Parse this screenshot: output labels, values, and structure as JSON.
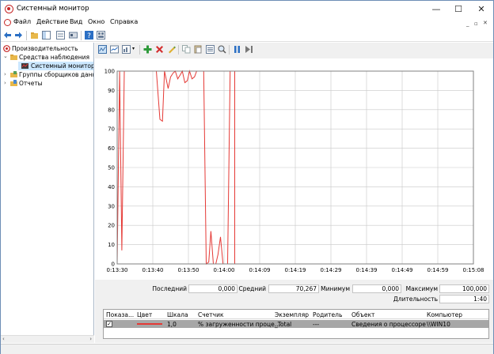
{
  "window": {
    "title": "Системный монитор",
    "minimize": "—",
    "maximize": "☐",
    "close": "✕"
  },
  "menu": [
    "Файл",
    "Действие",
    "Вид",
    "Окно",
    "Справка"
  ],
  "tree": {
    "root": "Производительность",
    "monitoring": "Средства наблюдения",
    "system_monitor": "Системный монитор",
    "collector_groups": "Группы сборщиков данн",
    "reports": "Отчеты"
  },
  "colors": {
    "series": "#e53935",
    "selection": "#cce8ff",
    "legend_row": "#a7a7a7"
  },
  "chart_data": {
    "type": "line",
    "y_ticks": [
      0,
      10,
      20,
      30,
      40,
      50,
      60,
      70,
      80,
      90,
      100
    ],
    "x_labels": [
      "0:13:30",
      "0:13:40",
      "0:13:50",
      "0:14:00",
      "0:14:09",
      "0:14:19",
      "0:14:29",
      "0:14:39",
      "0:14:49",
      "0:14:59",
      "0:15:08"
    ],
    "ylim": [
      0,
      100
    ],
    "duration_seconds": 100,
    "series": [
      {
        "x": [
          0,
          0.7,
          1.3,
          2,
          3,
          3.5,
          4.3,
          5.3,
          5.7,
          6.3,
          7.3,
          7.7,
          8.3,
          9,
          9.7,
          10.3,
          11,
          12,
          12.7,
          13.3,
          14.3,
          15,
          15.7,
          16.3,
          17,
          17.7,
          18.3,
          19,
          19.7,
          20.3,
          21,
          21.7,
          22.3,
          23,
          23.7,
          24.3,
          25,
          25.7,
          26.3,
          27,
          27.7,
          28.3,
          29,
          29.7,
          30.3,
          31,
          31.7,
          32.3,
          33
        ],
        "y": [
          0,
          100,
          7,
          100,
          100,
          100,
          100,
          100,
          100,
          100,
          100,
          100,
          100,
          100,
          100,
          100,
          100,
          75,
          74,
          100,
          91,
          97,
          99,
          100,
          96,
          98,
          100,
          94,
          95,
          100,
          96,
          97,
          100,
          100,
          100,
          100,
          0,
          1,
          17,
          0,
          0,
          5,
          14,
          0,
          0,
          0,
          100,
          100,
          100
        ]
      }
    ]
  },
  "stats": {
    "last_label": "Последний",
    "last": "0,000",
    "avg_label": "Средний",
    "avg": "70,267",
    "min_label": "Минимум",
    "min": "0,000",
    "max_label": "Максимум",
    "max": "100,000",
    "dur_label": "Длительность",
    "dur": "1:40"
  },
  "legend": {
    "headers": [
      "Показа...",
      "Цвет",
      "Шкала",
      "Счетчик",
      "Экземпляр",
      "Родитель",
      "Объект",
      "Компьютер"
    ],
    "row": {
      "show": "✓",
      "scale": "1,0",
      "counter": "% загруженности проце...",
      "instance": "_Total",
      "parent": "---",
      "object": "Сведения о процессоре",
      "computer": "\\\\WIN10"
    }
  }
}
